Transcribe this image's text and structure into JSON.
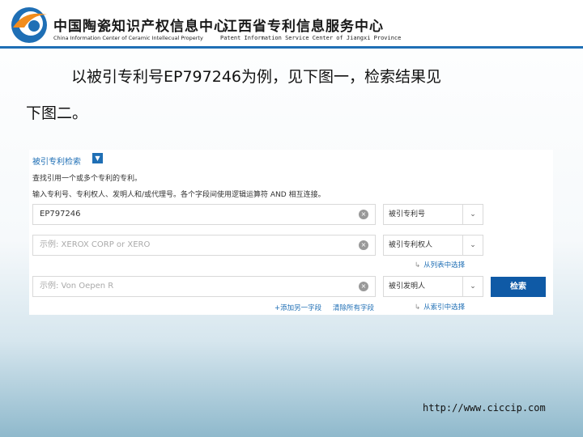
{
  "header": {
    "org1_cn": "中国陶瓷知识产权信息中心",
    "org1_en": "China Information Center of Ceramic Intellecual Property",
    "org2_cn": "江西省专利信息服务中心",
    "org2_en": "Patent Information Service Center of Jiangxi Province",
    "accent": "#1f6fb5"
  },
  "slide": {
    "line1": "以被引专利号EP797246为例，见下图一，检索结果见",
    "line2": "下图二。",
    "url": "http://www.ciccip.com"
  },
  "panel": {
    "title": "被引专利检索",
    "title_icon": "chevron-down-icon",
    "desc1": "查找引用一个或多个专利的专利。",
    "desc2": "输入专利号、专利权人、发明人和/或代理号。各个字段间使用逻辑运算符 AND 相互连接。",
    "rows": [
      {
        "input_value": "EP797246",
        "input_placeholder": "",
        "select": "被引专利号",
        "sub_link": ""
      },
      {
        "input_value": "",
        "input_placeholder": "示例: XEROX CORP or XERO",
        "select": "被引专利权人",
        "sub_link": "从列表中选择"
      },
      {
        "input_value": "",
        "input_placeholder": "示例: Von Oepen R",
        "select": "被引发明人",
        "sub_link": "从索引中选择"
      }
    ],
    "search_button": "检索",
    "add_row": "+添加另一字段",
    "clear_all": "清除所有字段",
    "button_color": "#0f5aa6"
  }
}
